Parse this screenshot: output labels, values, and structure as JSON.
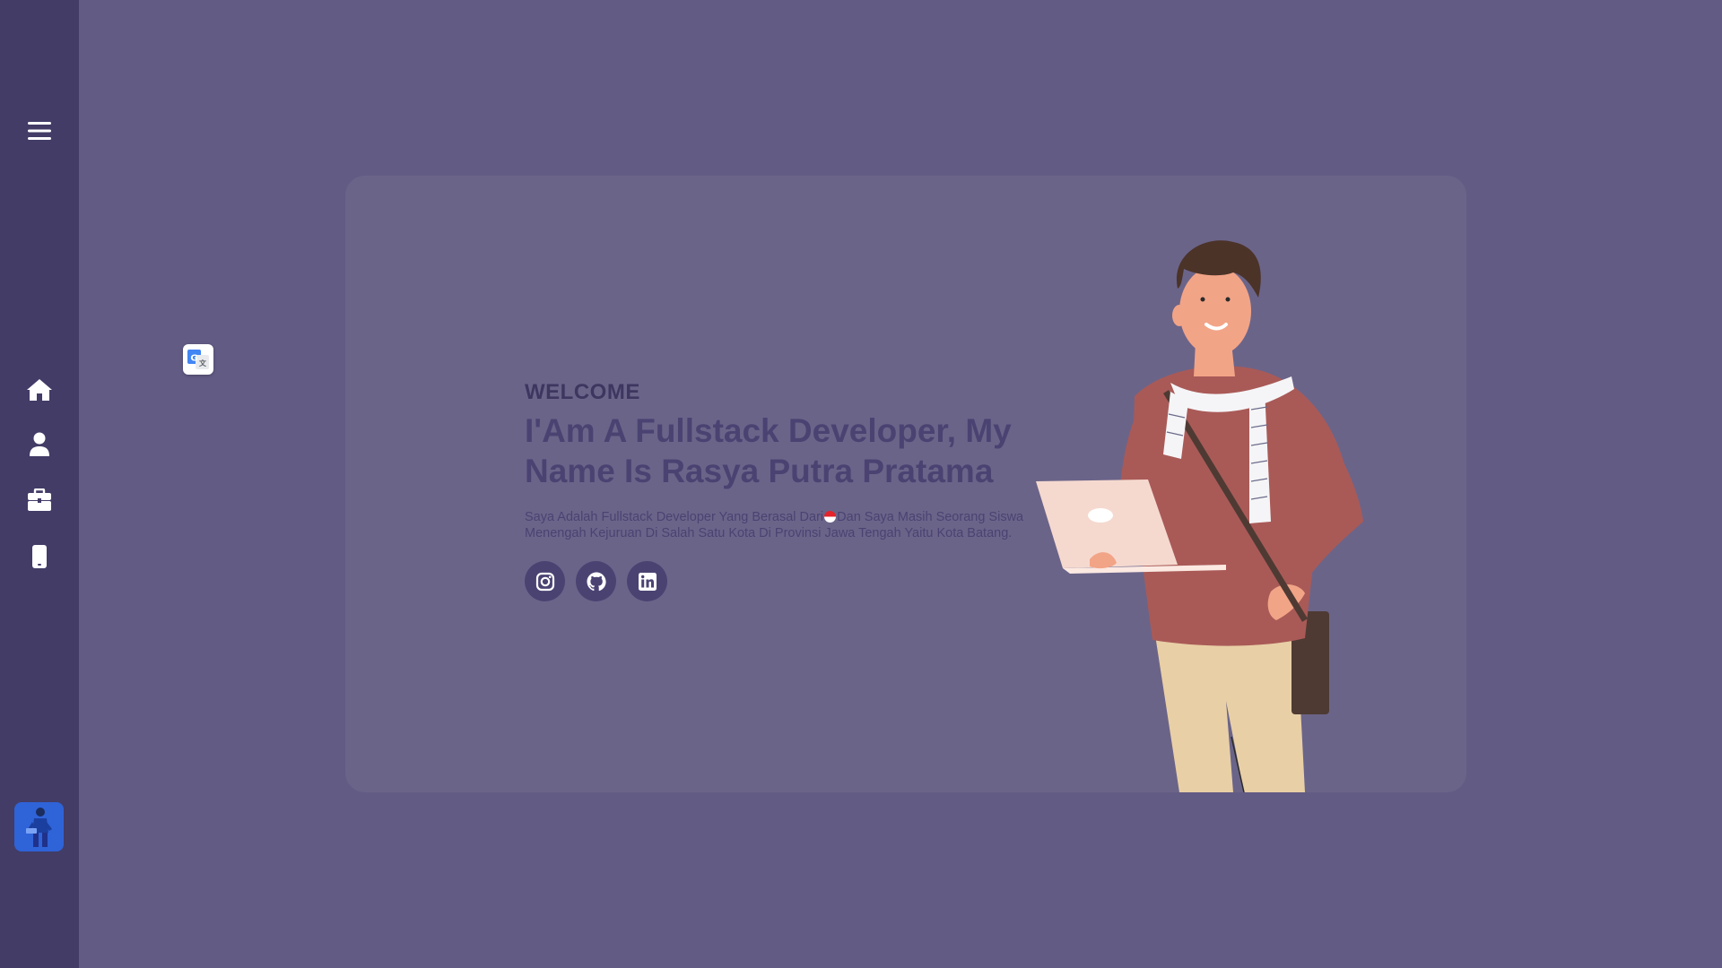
{
  "sidebar": {
    "menu_icon": "hamburger-menu-icon",
    "items": [
      {
        "name": "home",
        "icon": "home-icon"
      },
      {
        "name": "about",
        "icon": "user-icon"
      },
      {
        "name": "portfolio",
        "icon": "briefcase-icon"
      },
      {
        "name": "contact",
        "icon": "mobile-phone-icon"
      }
    ],
    "avatar": "avatar-icon"
  },
  "translate": {
    "icon": "google-translate-icon"
  },
  "hero": {
    "welcome": "WELCOME",
    "headline": "I'Am A Fullstack Developer, My Name Is Rasya Putra Pratama",
    "description_part1": "Saya Adalah Fullstack Developer Yang Berasal Dari",
    "description_part2": "Dan Saya Masih Seorang Siswa Menengah Kejuruan Di Salah Satu Kota Di Provinsi Jawa Tengah Yaitu Kota Batang.",
    "flag": "indonesia-flag-icon",
    "socials": [
      {
        "name": "instagram",
        "icon": "instagram-icon"
      },
      {
        "name": "github",
        "icon": "github-icon"
      },
      {
        "name": "linkedin",
        "icon": "linkedin-icon"
      }
    ]
  },
  "colors": {
    "background": "#625b84",
    "sidebar": "#423c67",
    "card": "#6b6489",
    "text_dark": "#4a4372",
    "avatar_bg": "#2f63d8"
  }
}
